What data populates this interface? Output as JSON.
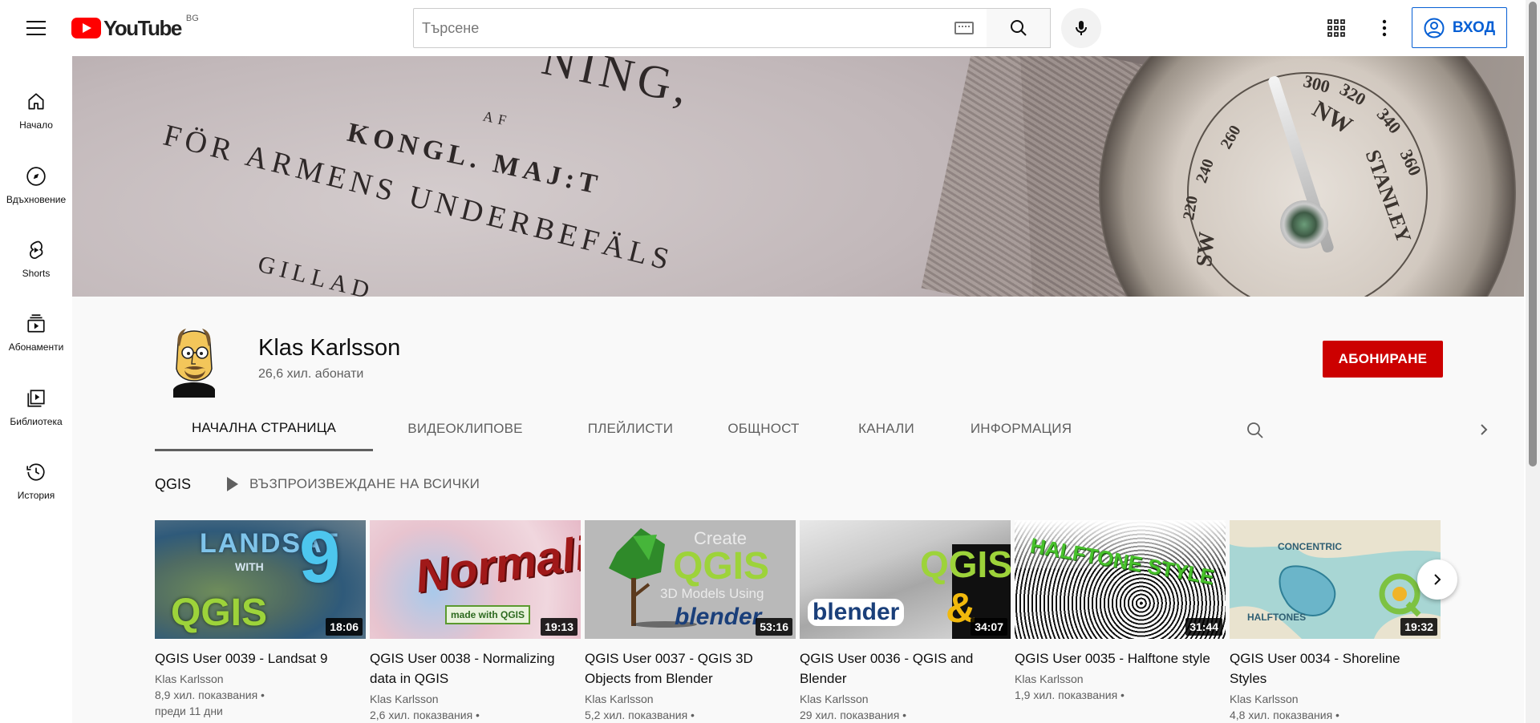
{
  "header": {
    "logo_text": "YouTube",
    "country": "BG",
    "search_placeholder": "Търсене",
    "signin_label": "ВХОД"
  },
  "sidebar": {
    "items": [
      {
        "label": "Начало",
        "icon": "home-icon"
      },
      {
        "label": "Вдъхновение",
        "icon": "explore-icon"
      },
      {
        "label": "Shorts",
        "icon": "shorts-icon"
      },
      {
        "label": "Абонаменти",
        "icon": "subscriptions-icon"
      },
      {
        "label": "Библиотека",
        "icon": "library-icon"
      },
      {
        "label": "История",
        "icon": "history-icon"
      }
    ]
  },
  "banner": {
    "lines": [
      "NING,",
      "AF",
      "KONGL. MAJ:T",
      "FÖR ARMENS UNDERBEFÄLS",
      "GILLAD"
    ],
    "compass_numbers": [
      "260",
      "240",
      "220",
      "SW",
      "300",
      "320",
      "NW",
      "340",
      "360",
      "STANLEY"
    ]
  },
  "channel": {
    "name": "Klas Karlsson",
    "subscribers": "26,6 хил. абонати",
    "subscribe_label": "АБОНИРАНЕ",
    "accent_color": "#cc0000"
  },
  "tabs": [
    {
      "label": "НАЧАЛНА СТРАНИЦА",
      "active": true
    },
    {
      "label": "ВИДЕОКЛИПОВЕ",
      "active": false
    },
    {
      "label": "ПЛЕЙЛИСТИ",
      "active": false
    },
    {
      "label": "ОБЩНОСТ",
      "active": false
    },
    {
      "label": "КАНАЛИ",
      "active": false
    },
    {
      "label": "ИНФОРМАЦИЯ",
      "active": false
    }
  ],
  "shelf": {
    "title": "QGIS",
    "play_all": "ВЪЗПРОИЗВЕЖДАНЕ НА ВСИЧКИ",
    "videos": [
      {
        "title": "QGIS User 0039 - Landsat 9",
        "channel": "Klas Karlsson",
        "views": "8,9 хил. показвания •",
        "age": "преди 11 дни",
        "duration": "18:06",
        "thumb": {
          "lines": [
            "LANDSAT",
            "WITH",
            "9",
            "QGIS"
          ]
        }
      },
      {
        "title": "QGIS User 0038 - Normalizing data in QGIS",
        "channel": "Klas Karlsson",
        "views": "2,6 хил. показвания •",
        "age": "",
        "duration": "19:13",
        "thumb": {
          "lines": [
            "Normalize",
            "made with QGIS"
          ]
        }
      },
      {
        "title": "QGIS User 0037 - QGIS 3D Objects from Blender",
        "channel": "Klas Karlsson",
        "views": "5,2 хил. показвания •",
        "age": "",
        "duration": "53:16",
        "thumb": {
          "lines": [
            "Create",
            "QGIS",
            "3D Models Using",
            "blender"
          ]
        }
      },
      {
        "title": "QGIS User 0036 - QGIS and Blender",
        "channel": "Klas Karlsson",
        "views": "29 хил. показвания •",
        "age": "",
        "duration": "34:07",
        "thumb": {
          "lines": [
            "QGIS",
            "blender",
            "&"
          ]
        }
      },
      {
        "title": "QGIS User 0035 - Halftone style",
        "channel": "Klas Karlsson",
        "views": "1,9 хил. показвания •",
        "age": "",
        "duration": "31:44",
        "thumb": {
          "lines": [
            "HALFTONE STYLE"
          ]
        }
      },
      {
        "title": "QGIS User 0034 - Shoreline Styles",
        "channel": "Klas Karlsson",
        "views": "4,8 хил. показвания •",
        "age": "",
        "duration": "19:32",
        "thumb": {
          "lines": [
            "CONCENTRIC",
            "HALFTONES"
          ]
        }
      }
    ]
  }
}
